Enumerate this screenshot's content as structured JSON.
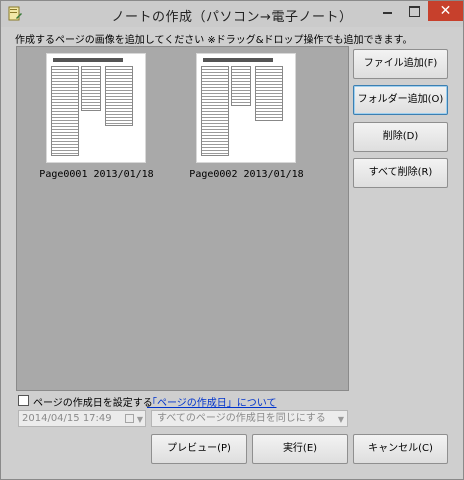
{
  "window": {
    "title": "ノートの作成（パソコン→電子ノート）",
    "close_glyph": "✕"
  },
  "instruction": "作成するページの画像を追加してください ※ドラッグ&ドロップ操作でも追加できます。",
  "pages": [
    {
      "caption": "Page0001 2013/01/18"
    },
    {
      "caption": "Page0002 2013/01/18"
    }
  ],
  "actions": {
    "add_file": "ファイル追加(F)",
    "add_folder": "フォルダー追加(O)",
    "delete": "削除(D)",
    "delete_all": "すべて削除(R)"
  },
  "date_setting": {
    "checkbox_label": "ページの作成日を設定する",
    "checked": false,
    "about_link": "「ページの作成日」について",
    "date_value": "2014/04/15 17:49",
    "scope_value": "すべてのページの作成日を同じにする"
  },
  "footer": {
    "preview": "プレビュー(P)",
    "run": "実行(E)",
    "cancel": "キャンセル(C)"
  },
  "colors": {
    "close_button": "#c7402c",
    "focus_border": "#3c7fb1",
    "link": "#0033cc"
  }
}
